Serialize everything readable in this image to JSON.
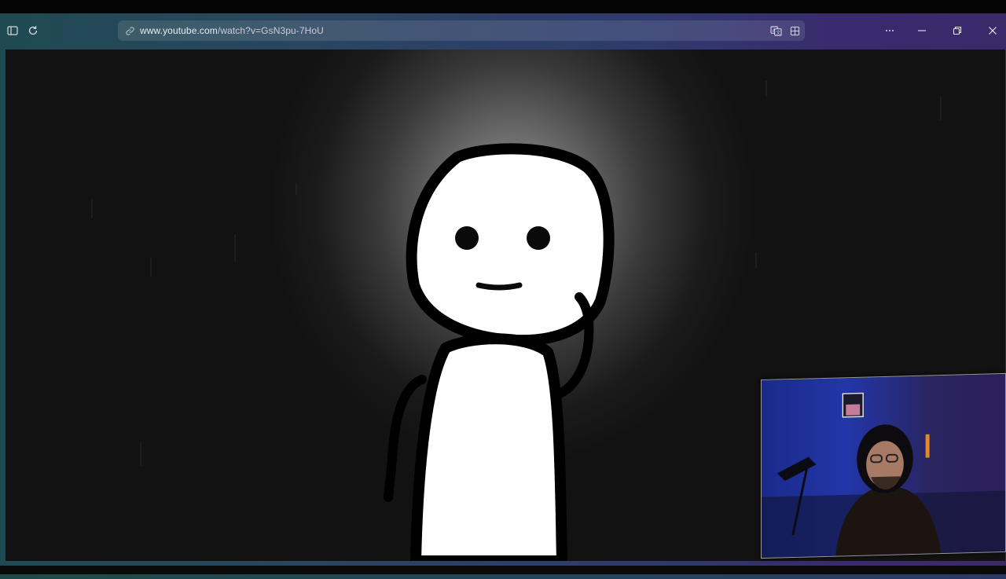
{
  "browser": {
    "address_bar": {
      "url_host": "www.youtube.com",
      "url_path": "/watch?v=GsN3pu-7HoU"
    },
    "icons": {
      "sidebar_toggle": "sidebar-toggle-icon",
      "reload": "reload-icon",
      "link": "link-icon",
      "translate": "translate-icon",
      "apps": "apps-grid-icon",
      "more": "more-options-icon",
      "minimize": "minimize-icon",
      "restore": "restore-icon",
      "close": "close-icon"
    },
    "accent_colors": {
      "frame_left": "#1f4a52",
      "frame_right": "#3b2a6a"
    }
  },
  "video": {
    "content": "stick-figure-animation",
    "overlay": "webcam-facecam"
  }
}
